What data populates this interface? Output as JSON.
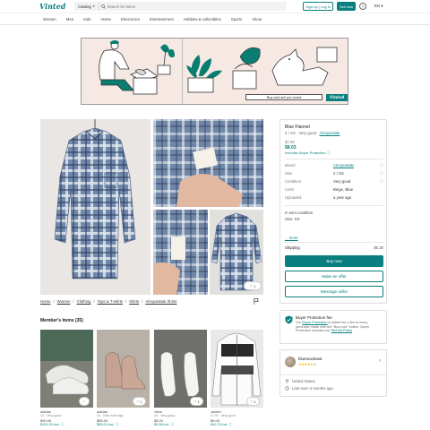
{
  "header": {
    "logo": "Vinted",
    "category_label": "Catalog",
    "search_placeholder": "Search for items",
    "signup_label": "Sign up | Log in",
    "sell_label": "Sell now",
    "help_icon": "?",
    "language": "EN"
  },
  "nav": {
    "items": [
      "Women",
      "Men",
      "Kids",
      "Home",
      "Electronics",
      "Entertainment",
      "Hobbies & collectibles",
      "Sports",
      "About"
    ]
  },
  "banner": {
    "cta": "Buy and sell pre-loved",
    "logo": "Vinted"
  },
  "listing": {
    "title": "Blue Flannel",
    "subtitle_size": "2 / XS · Very good ·",
    "subtitle_brand": "Aéropostale",
    "price": "$7.00",
    "price_with_protection": "$8.03",
    "protection_note": "Includes Buyer Protection ⓘ",
    "details": [
      {
        "key": "Brand",
        "value": "Aéropostale",
        "link": true,
        "icon": "ⓘ"
      },
      {
        "key": "Size",
        "value": "2 / XS",
        "link": false,
        "icon": "ⓘ"
      },
      {
        "key": "Condition",
        "value": "Very good",
        "link": false,
        "icon": "ⓘ"
      },
      {
        "key": "Color",
        "value": "Beige, Blue",
        "link": false,
        "icon": ""
      },
      {
        "key": "Uploaded",
        "value": "a year ago",
        "link": false,
        "icon": ""
      }
    ],
    "description_lines": [
      "In mint condition",
      "Size: XS"
    ],
    "more": "... more",
    "shipping_label": "Shipping",
    "shipping_value": "$6.30",
    "buy_label": "Buy now",
    "offer_label": "Make an offer",
    "message_label": "Message seller",
    "favorites": "1"
  },
  "breadcrumbs": [
    "Home",
    "Women",
    "Clothing",
    "Tops & T-shirts",
    "Shirts",
    "Aéropostale Shirts"
  ],
  "buyer_protection": {
    "title": "Buyer Protection fee",
    "text_prefix": "Our",
    "text_link": "Buyer Protection",
    "text_mid": "is added for a fee to every purchase made with the \"Buy now\" button. Buyer Protection includes our",
    "text_link2": "Refund Policy",
    "text_suffix": "."
  },
  "seller": {
    "name": "bluemacleast",
    "stars": "★★★★★",
    "review_count": "3",
    "location": "United States",
    "last_seen": "Last seen 4 months ago"
  },
  "members": {
    "title": "Member's items (35)",
    "items": [
      {
        "brand": "adidas",
        "meta": "10 · Very good",
        "price": "$90.00",
        "price2": "$100.25 incl. ⓘ",
        "fav": "",
        "img": "sneaker-white"
      },
      {
        "brand": "adidas",
        "meta": "10 · New with tags",
        "price": "$85.00",
        "price2": "$95.00 incl. ⓘ",
        "fav": "1",
        "img": "boot-pink"
      },
      {
        "brand": "Vans",
        "meta": "10 · Very good",
        "price": "$8.00",
        "price2": "$9.38 incl. ⓘ",
        "fav": "1",
        "img": "sneaker-clean"
      },
      {
        "brand": "Jacket",
        "meta": "S / M · Very good",
        "price": "$9.00",
        "price2": "$10.79 incl. ⓘ",
        "fav": "1",
        "img": "jacket"
      }
    ]
  },
  "colors": {
    "brand": "#09807f",
    "text": "#171717",
    "muted": "#777777"
  }
}
